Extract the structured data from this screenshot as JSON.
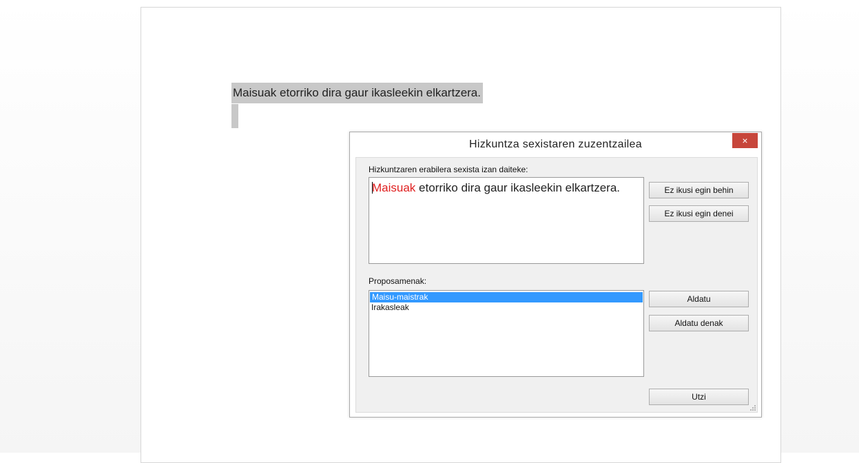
{
  "document": {
    "sentence": "Maisuak etorriko dira gaur ikasleekin elkartzera."
  },
  "dialog": {
    "title": "Hizkuntza sexistaren zuzentzailea",
    "close_glyph": "×",
    "sentence_label": "Hizkuntzaren erabilera sexista izan daiteke:",
    "sentence_highlight": "Maisuak",
    "sentence_rest": " etorriko dira gaur ikasleekin elkartzera.",
    "suggestions_label": "Proposamenak:",
    "suggestions": [
      "Maisu-maistrak",
      "Irakasleak"
    ],
    "selected_suggestion": "Maisu-maistrak",
    "buttons": {
      "ignore_once": "Ez ikusi egin behin",
      "ignore_all": "Ez ikusi egin denei",
      "change": "Aldatu",
      "change_all": "Aldatu denak",
      "cancel": "Utzi"
    },
    "highlight_color": "#e02020",
    "selection_color": "#3399ff",
    "close_color": "#c7463b"
  }
}
